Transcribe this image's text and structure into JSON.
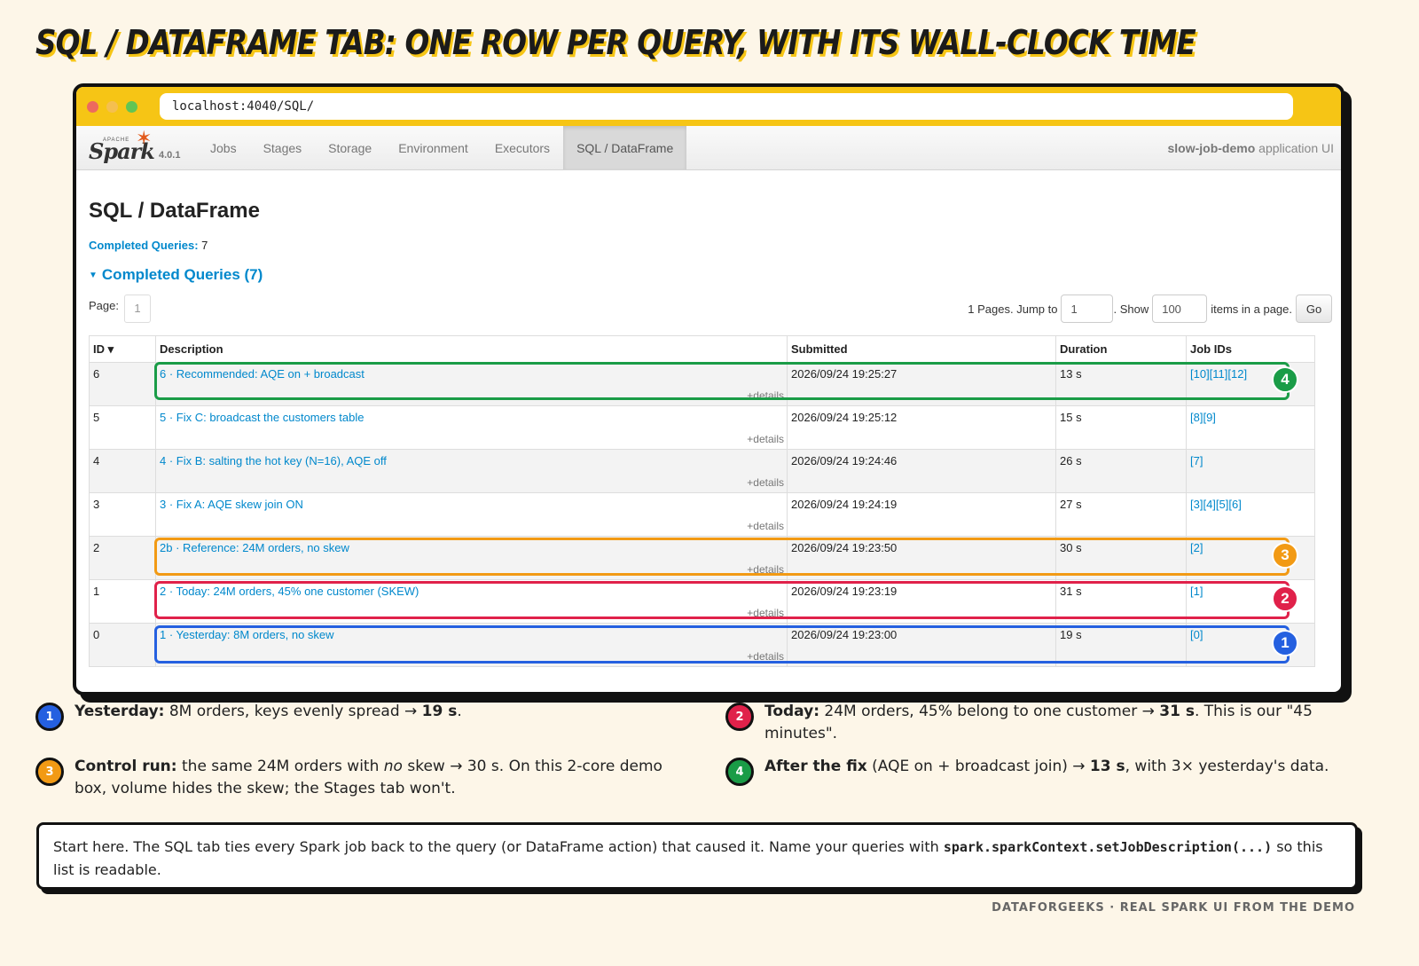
{
  "headline": "SQL / DataFrame tab: one row per query, with its wall-clock time",
  "browser": {
    "url": "localhost:4040/SQL/",
    "dot_colors": [
      "#ed6a5e",
      "#f5bf4f",
      "#61c554"
    ]
  },
  "navbar": {
    "logo_apache": "APACHE",
    "logo_text": "Spark",
    "version": "4.0.1",
    "tabs": [
      {
        "label": "Jobs",
        "active": false
      },
      {
        "label": "Stages",
        "active": false
      },
      {
        "label": "Storage",
        "active": false
      },
      {
        "label": "Environment",
        "active": false
      },
      {
        "label": "Executors",
        "active": false
      },
      {
        "label": "SQL / DataFrame",
        "active": true
      }
    ],
    "app_name": "slow-job-demo",
    "app_suffix": "application UI"
  },
  "page": {
    "title": "SQL / DataFrame",
    "summary_label": "Completed Queries:",
    "summary_value": "7",
    "section_title": "Completed Queries (7)"
  },
  "pager": {
    "page_label": "Page:",
    "page_value": "1",
    "pages_text": "1 Pages. Jump to",
    "jump_value": "1",
    "show_text": ". Show",
    "show_value": "100",
    "items_text": "items in a page.",
    "go_label": "Go"
  },
  "table": {
    "headers": [
      "ID ▾",
      "Description",
      "Submitted",
      "Duration",
      "Job IDs"
    ],
    "details_label": "+details",
    "rows": [
      {
        "id": "6",
        "desc": "6 · Recommended: AQE on + broadcast",
        "submitted": "2026/09/24 19:25:27",
        "duration": "13 s",
        "jobs": "[10][11][12]"
      },
      {
        "id": "5",
        "desc": "5 · Fix C: broadcast the customers table",
        "submitted": "2026/09/24 19:25:12",
        "duration": "15 s",
        "jobs": "[8][9]"
      },
      {
        "id": "4",
        "desc": "4 · Fix B: salting the hot key (N=16), AQE off",
        "submitted": "2026/09/24 19:24:46",
        "duration": "26 s",
        "jobs": "[7]"
      },
      {
        "id": "3",
        "desc": "3 · Fix A: AQE skew join ON",
        "submitted": "2026/09/24 19:24:19",
        "duration": "27 s",
        "jobs": "[3][4][5][6]"
      },
      {
        "id": "2",
        "desc": "2b · Reference: 24M orders, no skew",
        "submitted": "2026/09/24 19:23:50",
        "duration": "30 s",
        "jobs": "[2]"
      },
      {
        "id": "1",
        "desc": "2 · Today: 24M orders, 45% one customer (SKEW)",
        "submitted": "2026/09/24 19:23:19",
        "duration": "31 s",
        "jobs": "[1]"
      },
      {
        "id": "0",
        "desc": "1 · Yesterday: 8M orders, no skew",
        "submitted": "2026/09/24 19:23:00",
        "duration": "19 s",
        "jobs": "[0]"
      }
    ]
  },
  "highlights": [
    {
      "badge": "4",
      "color": "#1a9c47"
    },
    {
      "badge": "3",
      "color": "#f29a14"
    },
    {
      "badge": "2",
      "color": "#e0214a"
    },
    {
      "badge": "1",
      "color": "#2560e0"
    }
  ],
  "notes": [
    {
      "num": "1",
      "color": "#2560e0",
      "bold": "Yesterday:",
      "text": " 8M orders, keys evenly spread → ",
      "bold2": "19 s",
      "tail": "."
    },
    {
      "num": "2",
      "color": "#e0214a",
      "bold": "Today:",
      "text": " 24M orders, 45% belong to one customer → ",
      "bold2": "31 s",
      "tail": ". This is our \"45 minutes\"."
    },
    {
      "num": "3",
      "color": "#f29a14",
      "bold": "Control run:",
      "text": " the same 24M orders with ",
      "em": "no",
      "text2": " skew → 30 s. On this 2-core demo box, volume hides the skew; the Stages tab won't."
    },
    {
      "num": "4",
      "color": "#1a9c47",
      "bold": "After the fix",
      "text": " (AQE on + broadcast join) → ",
      "bold2": "13 s",
      "tail": ", with 3× yesterday's data."
    }
  ],
  "callout": {
    "text1": "Start here. The SQL tab ties every Spark job back to the query (or DataFrame action) that caused it. Name your queries with ",
    "code": "spark.sparkContext.setJobDescription(...)",
    "text2": " so this list is readable."
  },
  "footer": "DATAFORGEEKS · REAL SPARK UI FROM THE DEMO"
}
